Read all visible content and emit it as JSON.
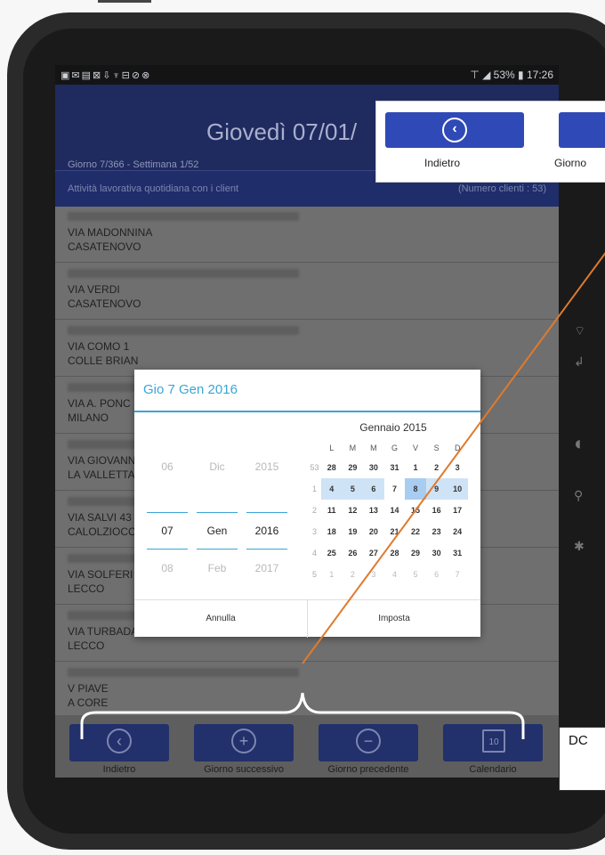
{
  "status_bar": {
    "left_icons": "▣✉▤⊠⇩♆⊟⊘⊗",
    "right": "⊤ ◢ 53% ▮ 17:26"
  },
  "header": {
    "date": "Giovedì 07/01/",
    "subtitle": "Giorno 7/366 - Settimana 1/52"
  },
  "activity_bar": {
    "title": "Attività lavorativa quotidiana con i client",
    "count": "(Numero clienti : 53)"
  },
  "clients": [
    {
      "street": "VIA MADONNINA",
      "city": "CASATENOVO"
    },
    {
      "street": "VIA VERDI",
      "city": "CASATENOVO"
    },
    {
      "street": "VIA COMO 1",
      "city": "COLLE BRIAN"
    },
    {
      "street": "VIA A. PONC",
      "city": "MILANO"
    },
    {
      "street": "VIA GIOVANN",
      "city": "LA VALLETTA"
    },
    {
      "street": "VIA SALVI 43",
      "city": "CALOLZIOCC"
    },
    {
      "street": "VIA SOLFERI",
      "city": "LECCO"
    },
    {
      "street": "VIA TURBADA",
      "city": "LECCO"
    },
    {
      "street": "V PIAVE",
      "city": "A CORE"
    }
  ],
  "dialog": {
    "title": "Gio 7 Gen 2016",
    "day": {
      "prev": "06",
      "current": "07",
      "next": "08"
    },
    "month": {
      "prev": "Dic",
      "current": "Gen",
      "next": "Feb"
    },
    "year": {
      "prev": "2015",
      "current": "2016",
      "next": "2017"
    },
    "calendar_month": "Gennaio 2015",
    "weekdays": [
      "L",
      "M",
      "M",
      "G",
      "V",
      "S",
      "D"
    ],
    "weeks": [
      {
        "wk": "53",
        "days": [
          "28",
          "29",
          "30",
          "31",
          "1",
          "2",
          "3"
        ]
      },
      {
        "wk": "1",
        "days": [
          "4",
          "5",
          "6",
          "7",
          "8",
          "9",
          "10"
        ]
      },
      {
        "wk": "2",
        "days": [
          "11",
          "12",
          "13",
          "14",
          "15",
          "16",
          "17"
        ]
      },
      {
        "wk": "3",
        "days": [
          "18",
          "19",
          "20",
          "21",
          "22",
          "23",
          "24"
        ]
      },
      {
        "wk": "4",
        "days": [
          "25",
          "26",
          "27",
          "28",
          "29",
          "30",
          "31"
        ]
      },
      {
        "wk": "5",
        "days": [
          "1",
          "2",
          "3",
          "4",
          "5",
          "6",
          "7"
        ]
      }
    ],
    "cancel_label": "Annulla",
    "confirm_label": "Imposta"
  },
  "bottom_bar": {
    "back_label": "Indietro",
    "next_day_label": "Giorno successivo",
    "prev_day_label": "Giorno precedente",
    "calendar_label": "Calendario",
    "calendar_icon_day": "10"
  },
  "callout": {
    "back_label": "Indietro",
    "next_label": "Giorno"
  },
  "doc_label": "DC",
  "colors": {
    "header_bg": "#1f2a5f",
    "button_bg": "#22306b",
    "callout_button": "#2f4ab6",
    "accent": "#3aa5d6",
    "annotation": "#e07a2c"
  }
}
